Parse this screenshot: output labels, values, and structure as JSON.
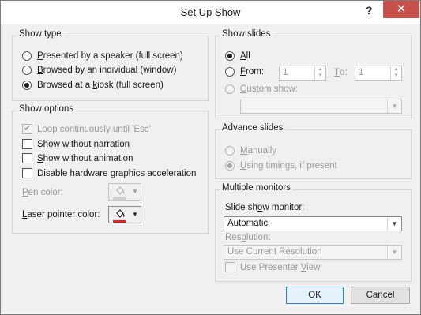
{
  "title": "Set Up Show",
  "title_buttons": {
    "help": "?",
    "close": "✕"
  },
  "show_type": {
    "title": "Show type",
    "options": [
      {
        "pre": "",
        "key": "P",
        "post": "resented by a speaker (full screen)",
        "selected": false
      },
      {
        "pre": "",
        "key": "B",
        "post": "rowsed by an individual (window)",
        "selected": false
      },
      {
        "pre": "Browsed at a ",
        "key": "k",
        "post": "iosk (full screen)",
        "selected": true
      }
    ]
  },
  "show_options": {
    "title": "Show options",
    "loop": {
      "pre": "",
      "key": "L",
      "post": "oop continuously until 'Esc'",
      "checked": true,
      "disabled": true
    },
    "no_narration": {
      "pre": "Show without ",
      "key": "n",
      "post": "arration",
      "checked": false
    },
    "no_animation": {
      "pre": "",
      "key": "S",
      "post": "how without animation",
      "checked": false
    },
    "no_hw_accel": {
      "pre": "Disable hardware ",
      "key": "g",
      "post": "raphics acceleration",
      "checked": false
    },
    "pen_color": {
      "pre": "",
      "key": "P",
      "post": "en color:",
      "color": "#cfcfcf",
      "disabled": true
    },
    "laser_color": {
      "pre": "",
      "key": "L",
      "post": "aser pointer color:",
      "color": "#e02020"
    }
  },
  "show_slides": {
    "title": "Show slides",
    "all": {
      "pre": "",
      "key": "A",
      "post": "ll",
      "selected": true
    },
    "from": {
      "pre": "",
      "key": "F",
      "post": "rom:",
      "selected": false,
      "value": "1"
    },
    "to": {
      "pre": "",
      "key": "T",
      "post": "o:",
      "value": "1"
    },
    "custom": {
      "pre": "",
      "key": "C",
      "post": "ustom show:",
      "selected": false,
      "disabled": true,
      "value": ""
    }
  },
  "advance_slides": {
    "title": "Advance slides",
    "manually": {
      "pre": "",
      "key": "M",
      "post": "anually",
      "selected": false
    },
    "timings": {
      "pre": "",
      "key": "U",
      "post": "sing timings, if present",
      "selected": true
    }
  },
  "multiple_monitors": {
    "title": "Multiple monitors",
    "monitor_label": {
      "pre": "Slide sh",
      "key": "o",
      "post": "w monitor:"
    },
    "monitor_value": "Automatic",
    "resolution_label": {
      "pre": "Res",
      "key": "o",
      "post": "lution:"
    },
    "resolution_value": "Use Current Resolution",
    "presenter_view": {
      "pre": "Use Presenter ",
      "key": "V",
      "post": "iew",
      "checked": false
    }
  },
  "buttons": {
    "ok": "OK",
    "cancel": "Cancel"
  }
}
